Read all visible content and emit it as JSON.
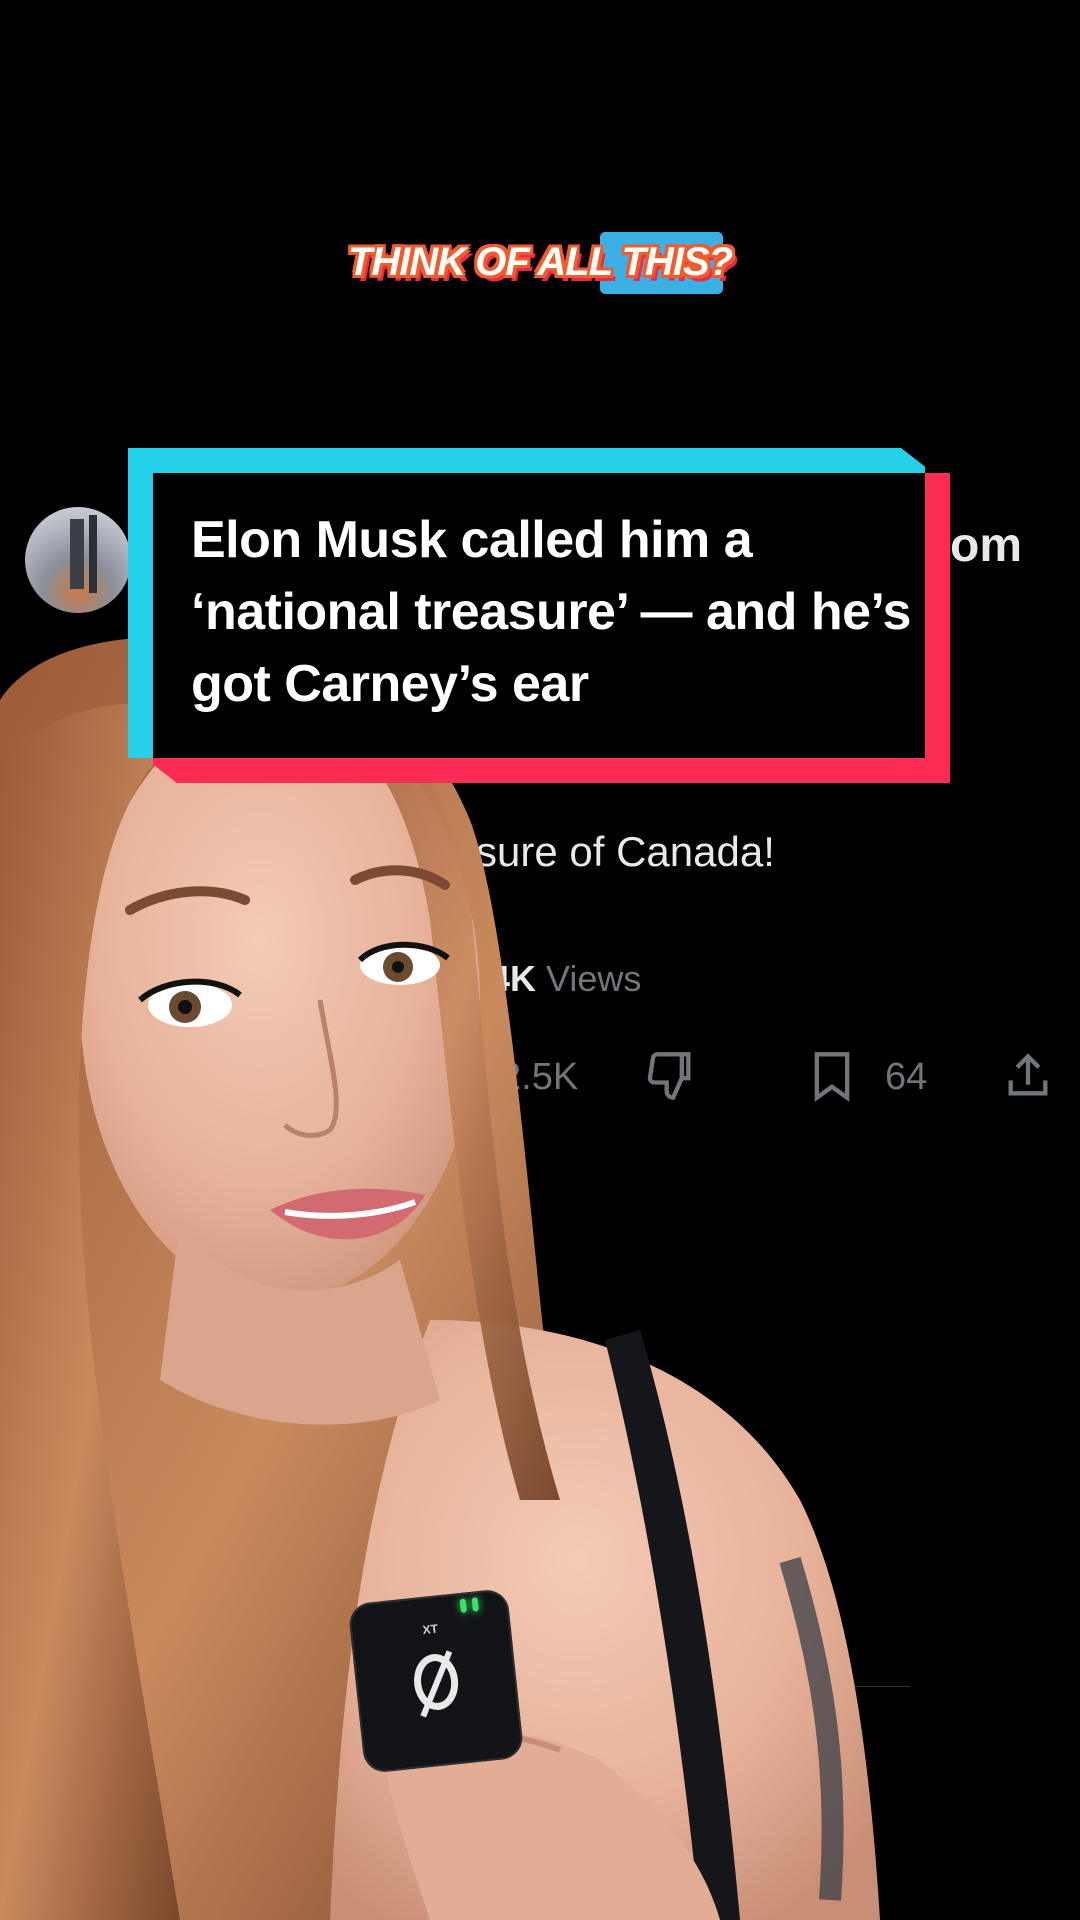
{
  "caption": {
    "text": "THINK OF ALL THIS?"
  },
  "headline": {
    "text": "Elon Musk called him a ‘national treasure’ — and he’s got Carney’s ear"
  },
  "tweet": {
    "handle_fragment": "om",
    "body_fragment": "sure of Canada!",
    "views_count_fragment": "4K",
    "views_label": "Views",
    "likes_fragment": "2.5K",
    "bookmarks_count": "64"
  },
  "microphone": {
    "brand": "XT"
  },
  "colors": {
    "caption_outline": "#f25c2a",
    "caption_highlight": "#3ab0e4",
    "headline_cyan": "#25d1e8",
    "headline_red": "#fe2c55",
    "background": "#000000"
  },
  "icons": [
    "dislike-icon",
    "bookmark-icon",
    "share-icon"
  ]
}
